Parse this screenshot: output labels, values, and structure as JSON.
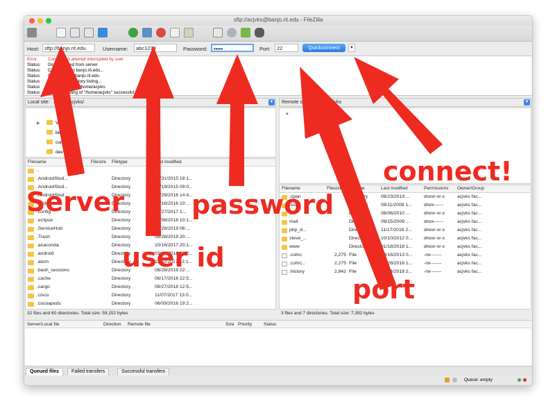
{
  "window": {
    "title": "sftp://acjvks@banjo.rit.edu - FileZilla"
  },
  "toolbar": {
    "icons": [
      "site-manager-icon",
      "log-toggle-icon",
      "tree-toggle-icon",
      "remote-tree-icon",
      "transfer-queue-icon",
      "refresh-icon",
      "process-queue-icon",
      "cancel-icon",
      "cancel-transfer-icon",
      "reconnect-icon",
      "filter-icon",
      "search-icon",
      "compare-icon",
      "binoculars-icon"
    ]
  },
  "quickconnect": {
    "host_label": "Host:",
    "host_value": "sftp://banjo.rit.edu",
    "username_label": "Username:",
    "username_value": "abc1234",
    "password_label": "Password:",
    "password_value": "•••••",
    "port_label": "Port:",
    "port_value": "22",
    "button_label": "Quickconnect",
    "dropdown": "▼"
  },
  "log": [
    {
      "kind": "Error:",
      "msg": "Connection attempt interrupted by user",
      "color": "#d9261c"
    },
    {
      "kind": "Status:",
      "msg": "Disconnected from server"
    },
    {
      "kind": "Status:",
      "msg": "Connecting to banjo.rit.edu..."
    },
    {
      "kind": "Status:",
      "msg": "Connected to banjo.rit.edu"
    },
    {
      "kind": "Status:",
      "msg": "Retrieving directory listing..."
    },
    {
      "kind": "Status:",
      "msg": "Listing directory /home/acjvks"
    },
    {
      "kind": "Status:",
      "msg": "Directory listing of \"/home/acjvks\" successful"
    }
  ],
  "local": {
    "path_label": "Local site:",
    "path_value": "/Users/acjvks/",
    "tree": [
      "Volumes",
      "bin",
      "cores",
      "dev"
    ],
    "headers": {
      "name": "Filename",
      "size": "Filesize",
      "type": "Filetype",
      "modified": "Last modified"
    },
    "files": [
      {
        "name": "..",
        "size": "",
        "type": "",
        "modified": ""
      },
      {
        "name": ".AndroidStud...",
        "size": "",
        "type": "Directory",
        "modified": "12/31/2015 18:1..."
      },
      {
        "name": ".AndroidStud...",
        "size": "",
        "type": "Directory",
        "modified": "01/19/2015 09:0..."
      },
      {
        "name": ".AndroidStud...",
        "size": "",
        "type": "Directory",
        "modified": "09/29/2016 14:4..."
      },
      {
        "name": ".android",
        "size": "",
        "type": "Directory",
        "modified": "10/16/2016 10:..."
      },
      {
        "name": ".config",
        "size": "",
        "type": "Directory",
        "modified": "02/27/2017 1..."
      },
      {
        "name": ".eclipse",
        "size": "",
        "type": "Directory",
        "modified": "03/08/2018 10:1..."
      },
      {
        "name": ".ServiceHub",
        "size": "",
        "type": "Directory",
        "modified": "02/28/2019 06:..."
      },
      {
        "name": ".Trash",
        "size": "",
        "type": "Directory",
        "modified": "08/28/2019 20:..."
      },
      {
        "name": ".anaconda",
        "size": "",
        "type": "Directory",
        "modified": "10/16/2017 20:1..."
      },
      {
        "name": ".android",
        "size": "",
        "type": "Directory",
        "modified": "03/13/2018 09:2..."
      },
      {
        "name": ".atom",
        "size": "",
        "type": "Directory",
        "modified": "11/02/2017 12:1..."
      },
      {
        "name": ".bash_sessions",
        "size": "",
        "type": "Directory",
        "modified": "08/28/2019 22:..."
      },
      {
        "name": ".cache",
        "size": "",
        "type": "Directory",
        "modified": "06/17/2016 22:5..."
      },
      {
        "name": ".cargo",
        "size": "",
        "type": "Directory",
        "modified": "09/27/2018 12:5..."
      },
      {
        "name": ".cisco",
        "size": "",
        "type": "Directory",
        "modified": "11/07/2017 13:0..."
      },
      {
        "name": ".cocoapods",
        "size": "",
        "type": "Directory",
        "modified": "06/09/2016 19:2..."
      },
      {
        "name": ".conda",
        "size": "",
        "type": "Directory",
        "modified": "08/19/2019 14:2..."
      }
    ],
    "status": "32 files and 60 directories. Total size: 59,152 bytes"
  },
  "remote": {
    "path_label": "Remote site:",
    "path_value": "/home/acjvks",
    "headers": {
      "name": "Filename",
      "size": "Filesize",
      "type": "Filetype",
      "modified": "Last modified",
      "perms": "Permissions",
      "owner": "Owner/Group"
    },
    "files": [
      {
        "name": ".cpan",
        "size": "",
        "type": "Directory",
        "modified": "08/23/2019 ...",
        "perms": "drwxr-xr-x",
        "owner": "acjvks fac..."
      },
      {
        "name": ".ssh",
        "size": "",
        "type": "Directory",
        "modified": "09/11/2008 1...",
        "perms": "drwx------",
        "owner": "acjvks fac..."
      },
      {
        "name": "bin",
        "size": "",
        "type": "Directory",
        "modified": "06/06/2010 ...",
        "perms": "drwxr-xr-x",
        "owner": "acjvks fac..."
      },
      {
        "name": "mail",
        "size": "",
        "type": "Directory",
        "modified": "09/15/2009 ...",
        "perms": "drwx------",
        "owner": "acjvks fac..."
      },
      {
        "name": "php_d...",
        "size": "",
        "type": "Directory",
        "modified": "11/17/2016 2...",
        "perms": "drwxr-xr-x",
        "owner": "acjvks fac..."
      },
      {
        "name": "steve_...",
        "size": "",
        "type": "Directory",
        "modified": "10/10/2012 0...",
        "perms": "drwxr-xr-x",
        "owner": "acjvks fac..."
      },
      {
        "name": "www",
        "size": "",
        "type": "Directory",
        "modified": "01/18/2018 1...",
        "perms": "drwxr-xr-x",
        "owner": "acjvks fac..."
      },
      {
        "name": ".cshrc",
        "size": "2,275",
        "type": "File",
        "modified": "10/16/2013 0...",
        "perms": "-rw-------",
        "owner": "acjvks fac..."
      },
      {
        "name": ".cshrc...",
        "size": "2,275",
        "type": "File",
        "modified": "04/28/2016 1...",
        "perms": "-rw-------",
        "owner": "acjvks fac..."
      },
      {
        "name": ".history",
        "size": "2,842",
        "type": "File",
        "modified": "12/04/2018 2...",
        "perms": "-rw-------",
        "owner": "acjvks fac..."
      }
    ],
    "status": "3 files and 7 directories. Total size: 7,392 bytes"
  },
  "queue": {
    "headers": {
      "file": "Server/Local file",
      "dir": "Direction",
      "remote": "Remote file",
      "size": "Size",
      "priority": "Priority",
      "status": "Status"
    },
    "tabs": [
      "Queued files",
      "Failed transfers",
      "Successful transfers"
    ],
    "status_text": "Queue: empty"
  },
  "annotations": {
    "server": "Server",
    "password": "password",
    "userid": "user id",
    "connect": "connect!",
    "port": "port",
    "color": "#ee2b21"
  }
}
